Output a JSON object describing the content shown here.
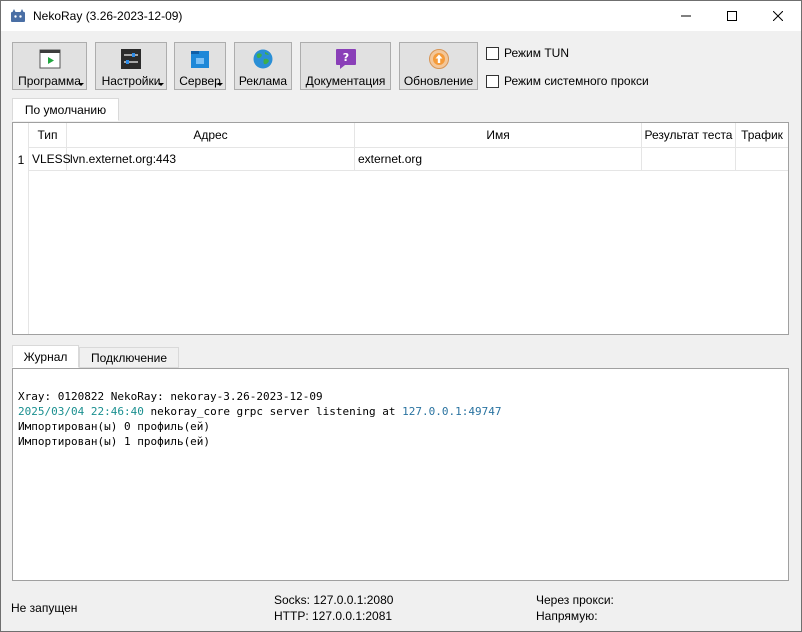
{
  "window": {
    "title": "NekoRay (3.26-2023-12-09)"
  },
  "toolbar": {
    "buttons": [
      {
        "label": "Программа",
        "icon": "terminal-play-icon",
        "dropdown": true
      },
      {
        "label": "Настройки",
        "icon": "sliders-icon",
        "dropdown": true
      },
      {
        "label": "Сервер",
        "icon": "server-icon",
        "dropdown": true
      },
      {
        "label": "Реклама",
        "icon": "globe-icon",
        "dropdown": false
      },
      {
        "label": "Документация",
        "icon": "help-icon",
        "dropdown": false
      },
      {
        "label": "Обновление",
        "icon": "update-icon",
        "dropdown": false
      }
    ],
    "tun_mode": {
      "label": "Режим TUN",
      "checked": false
    },
    "system_proxy": {
      "label": "Режим системного прокси",
      "checked": false
    }
  },
  "groups": {
    "tabs": [
      "По умолчанию"
    ],
    "active": 0
  },
  "servers": {
    "columns": [
      "Тип",
      "Адрес",
      "Имя",
      "Результат теста",
      "Трафик"
    ],
    "rows": [
      {
        "num": "1",
        "type": "VLESS",
        "address": "lvn.externet.org:443",
        "name": "externet.org",
        "test": "",
        "traffic": ""
      }
    ]
  },
  "bottom_tabs": {
    "tabs": [
      "Журнал",
      "Подключение"
    ],
    "active": 0
  },
  "log": {
    "lines": [
      {
        "text": "Xray: 0120822 NekoRay: nekoray-3.26-2023-12-09"
      },
      {
        "ts": "2025/03/04 22:46:40",
        "mid": " nekoray_core grpc server listening at ",
        "addr": "127.0.0.1:49747"
      },
      {
        "text": "Импортирован(ы) 0 профиль(ей)"
      },
      {
        "text": "Импортирован(ы) 1 профиль(ей)"
      }
    ]
  },
  "statusbar": {
    "state": "Не запущен",
    "socks": "Socks: 127.0.0.1:2080",
    "http": "HTTP: 127.0.0.1:2081",
    "via_proxy": "Через прокси:",
    "direct": "Напрямую:"
  },
  "colors": {
    "log_timestamp": "#1a8f8f",
    "log_address": "#2a73a0"
  }
}
